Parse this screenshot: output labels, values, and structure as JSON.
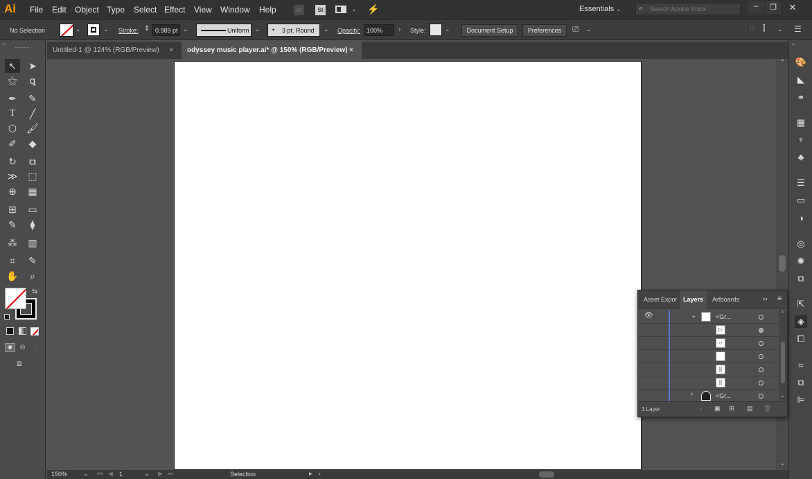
{
  "app": {
    "logo": "Ai",
    "logo_color": "#ff9a00"
  },
  "menu": [
    "File",
    "Edit",
    "Object",
    "Type",
    "Select",
    "Effect",
    "View",
    "Window",
    "Help"
  ],
  "menu_icons": [
    "Br",
    "St"
  ],
  "workspace": {
    "label": "Essentials"
  },
  "search": {
    "placeholder": "Search Adobe Stock"
  },
  "control": {
    "selection_label": "No Selection",
    "stroke_label": "Stroke:",
    "stroke_value": "0.989 pt",
    "profile": "Uniform",
    "brush": "3 pt. Round",
    "opacity_label": "Opacity:",
    "opacity_value": "100%",
    "style_label": "Style:",
    "doc_setup": "Document Setup",
    "preferences": "Preferences"
  },
  "tabs": [
    {
      "label": "Untitled-1 @ 124% (RGB/Preview)",
      "close": "×"
    },
    {
      "label": "odyssey music player.ai* @ 150% (RGB/Preview)",
      "close": "×"
    }
  ],
  "layers_panel": {
    "tabs": [
      "Asset Expor",
      "Layers",
      "Artboards"
    ],
    "rows": [
      {
        "name": "<Gr..."
      },
      {
        "name": ""
      },
      {
        "name": ""
      },
      {
        "name": ""
      },
      {
        "name": ""
      },
      {
        "name": ""
      },
      {
        "name": "<Gr..."
      }
    ],
    "footer": "1 Layer",
    "layer_color": "#4a78d8"
  },
  "status": {
    "zoom": "150%",
    "artboard": "1",
    "tool": "Selection"
  }
}
